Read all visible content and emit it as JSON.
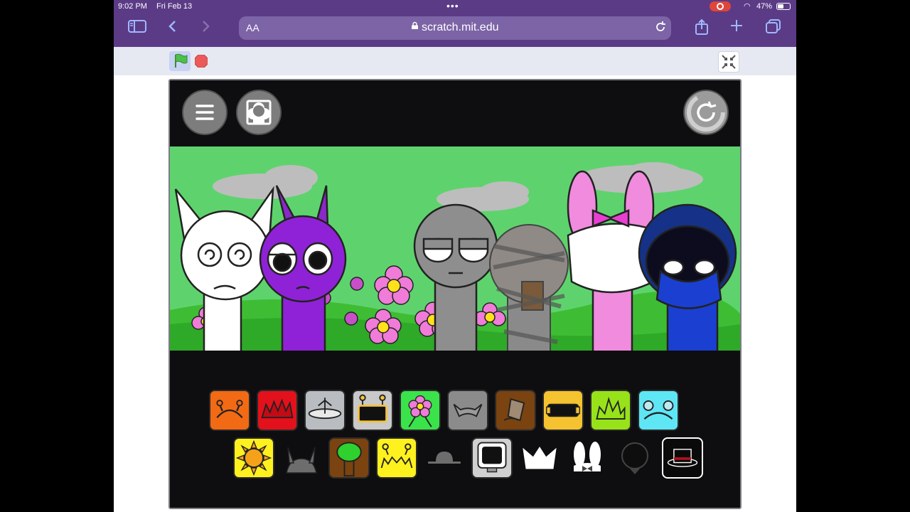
{
  "status": {
    "time": "9:02 PM",
    "date": "Fri Feb 13",
    "battery": "47%"
  },
  "browser": {
    "aa_label": "AA",
    "url": "scratch.mit.edu"
  },
  "stage_icons_row1": [
    "orange-antenna",
    "red-spikes",
    "silver-cymbal",
    "robot-screen",
    "flower",
    "gray-cat-ears",
    "bucket",
    "yellow-visor",
    "lime-spikes",
    "cyan-bear-ears"
  ],
  "stage_icons_row2": [
    "sun",
    "viking-horns",
    "tree",
    "yellow-antenna",
    "bowler-hat",
    "computer",
    "white-crown",
    "bunny-bow",
    "black-bomb",
    "black-top-hat"
  ],
  "colors": {
    "safari_bar": "#5b3b86",
    "stage_bg": "#0e0d10",
    "grass": "#5ed36d"
  }
}
